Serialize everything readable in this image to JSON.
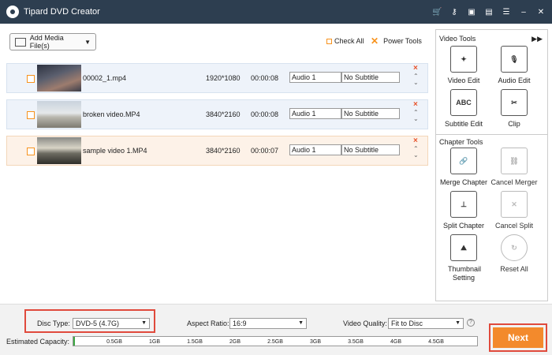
{
  "app": {
    "title": "Tipard DVD Creator"
  },
  "toolbar": {
    "add_media": "Add Media File(s)",
    "check_all": "Check All",
    "power_tools": "Power Tools"
  },
  "files": [
    {
      "name": "00002_1.mp4",
      "resolution": "1920*1080",
      "duration": "00:00:08",
      "audio": "Audio 1",
      "subtitle": "No Subtitle"
    },
    {
      "name": "broken video.MP4",
      "resolution": "3840*2160",
      "duration": "00:00:08",
      "audio": "Audio 1",
      "subtitle": "No Subtitle"
    },
    {
      "name": "sample video 1.MP4",
      "resolution": "3840*2160",
      "duration": "00:00:07",
      "audio": "Audio 1",
      "subtitle": "No Subtitle"
    }
  ],
  "video_tools": {
    "title": "Video Tools",
    "items": [
      "Video Edit",
      "Audio Edit",
      "Subtitle Edit",
      "Clip"
    ]
  },
  "chapter_tools": {
    "title": "Chapter Tools",
    "items": [
      "Merge Chapter",
      "Cancel Merger",
      "Split Chapter",
      "Cancel Split",
      "Thumbnail Setting",
      "Reset All"
    ]
  },
  "bottom": {
    "disc_type_label": "Disc Type:",
    "disc_type_value": "DVD-5 (4.7G)",
    "aspect_label": "Aspect Ratio:",
    "aspect_value": "16:9",
    "quality_label": "Video Quality:",
    "quality_value": "Fit to Disc",
    "capacity_label": "Estimated Capacity:",
    "capacity_ticks": [
      "0.5GB",
      "1GB",
      "1.5GB",
      "2GB",
      "2.5GB",
      "3GB",
      "3.5GB",
      "4GB",
      "4.5GB"
    ],
    "help": "?"
  },
  "next_label": "Next"
}
